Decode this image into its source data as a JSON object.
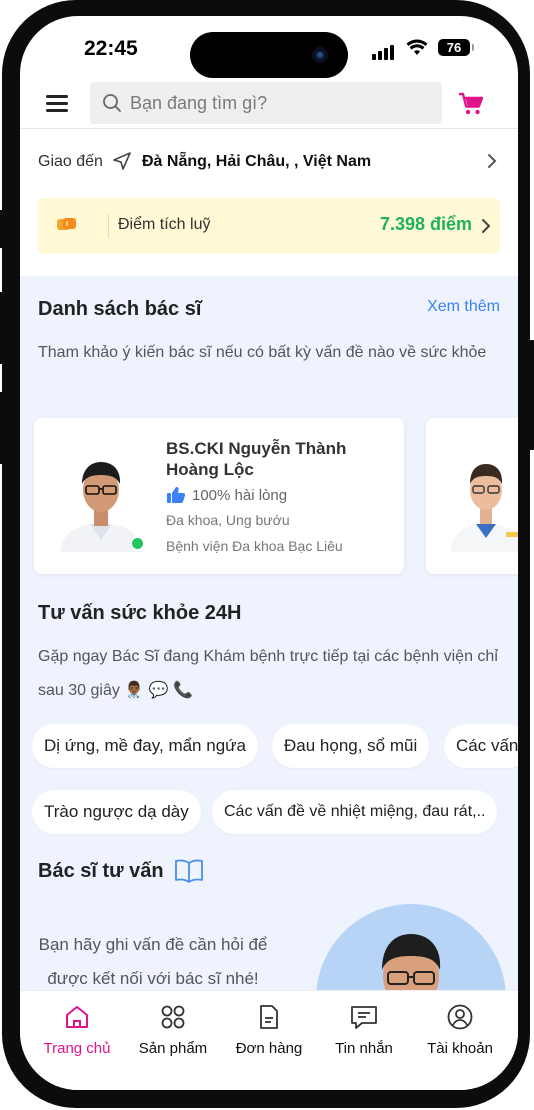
{
  "status_bar": {
    "time": "22:45",
    "battery": "76"
  },
  "header": {
    "search_placeholder": "Bạn đang tìm gì?"
  },
  "delivery": {
    "label": "Giao đến",
    "address": "Đà Nẵng, Hải Châu, , Việt Nam"
  },
  "points": {
    "label": "Điểm tích luỹ",
    "value": "7.398 điểm"
  },
  "doctors": {
    "title": "Danh sách bác sĩ",
    "see_more": "Xem thêm",
    "description": "Tham khảo ý kiến bác sĩ nếu có bất kỳ vấn đề nào về sức khỏe",
    "items": [
      {
        "name": "BS.CKI Nguyễn Thành Hoàng Lộc",
        "rating": "100% hài lòng",
        "specialty": "Đa khoa, Ung bướu",
        "hospital": "Bệnh viện Đa khoa Bạc Liêu"
      }
    ]
  },
  "health24": {
    "title": "Tư vấn sức khỏe 24H",
    "description": "Gặp ngay Bác Sĩ đang Khám bệnh trực tiếp tại các bệnh viện chỉ sau 30 giây 👨🏾‍⚕️ 💬 📞",
    "chips_row1": [
      "Dị ứng, mề đay, mẩn ngứa",
      "Đau họng, sổ mũi",
      "Các vấn"
    ],
    "chips_row2": [
      "Trào ngược dạ dày",
      "Các vấn đề về nhiệt miệng, đau rát,.."
    ]
  },
  "consult": {
    "title": "Bác sĩ tư vấn",
    "text": "Bạn hãy ghi vấn đề cần hỏi để được kết nối với bác sĩ nhé!"
  },
  "tabbar": {
    "items": [
      {
        "label": "Trang chủ",
        "icon": "home-icon",
        "active": true
      },
      {
        "label": "Sản phẩm",
        "icon": "grid-icon",
        "active": false
      },
      {
        "label": "Đơn hàng",
        "icon": "document-icon",
        "active": false
      },
      {
        "label": "Tin nhắn",
        "icon": "chat-icon",
        "active": false
      },
      {
        "label": "Tài khoản",
        "icon": "user-icon",
        "active": false
      }
    ]
  },
  "colors": {
    "accent": "#e0138c",
    "points_green": "#1fb25a",
    "link_blue": "#3b82f6",
    "section_bg": "#eef3fd"
  }
}
